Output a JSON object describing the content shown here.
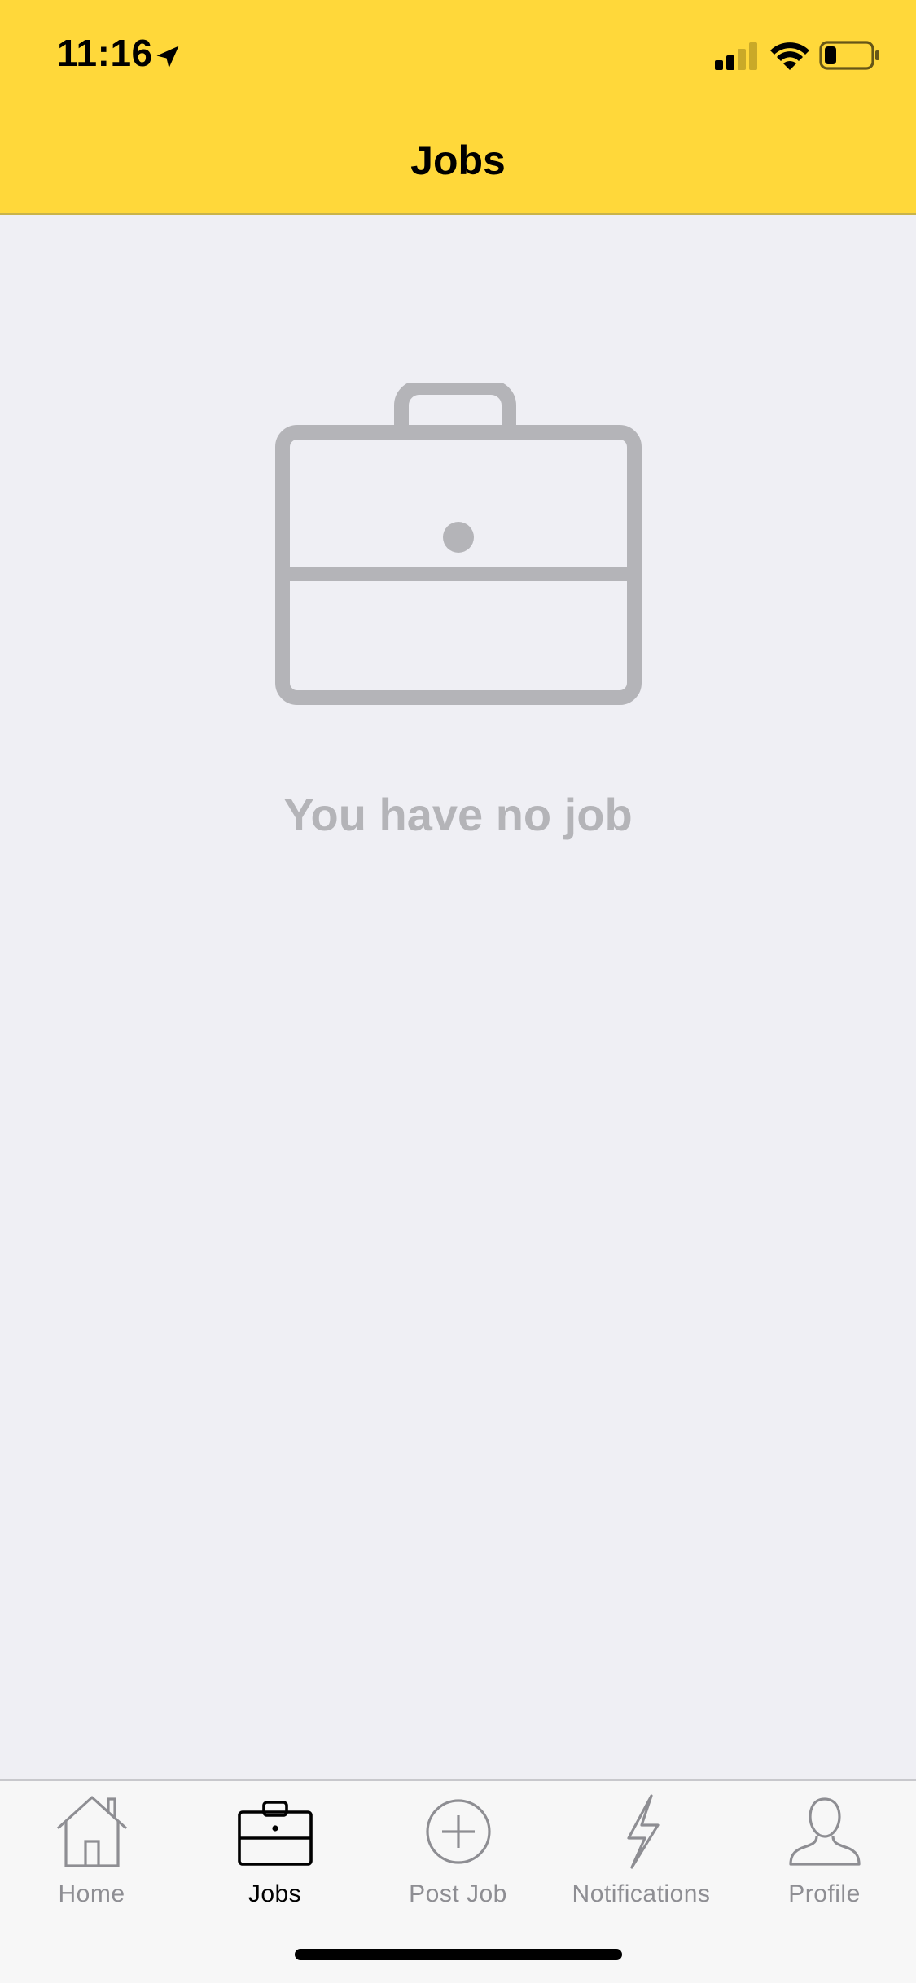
{
  "status_bar": {
    "time": "11:16",
    "location_icon": "location-arrow-icon",
    "signal_icon": "cellular-signal-icon",
    "wifi_icon": "wifi-icon",
    "battery_icon": "battery-icon",
    "battery_level": 0.25,
    "signal_bars_active": 2
  },
  "header": {
    "title": "Jobs",
    "background_color": "#ffd83a"
  },
  "empty_state": {
    "icon": "briefcase-icon",
    "message": "You have no job",
    "icon_color": "#b4b4b8"
  },
  "tab_bar": {
    "active_index": 1,
    "items": [
      {
        "label": "Home",
        "icon": "home-icon"
      },
      {
        "label": "Jobs",
        "icon": "briefcase-icon"
      },
      {
        "label": "Post Job",
        "icon": "plus-circle-icon"
      },
      {
        "label": "Notifications",
        "icon": "lightning-icon"
      },
      {
        "label": "Profile",
        "icon": "person-icon"
      }
    ]
  }
}
